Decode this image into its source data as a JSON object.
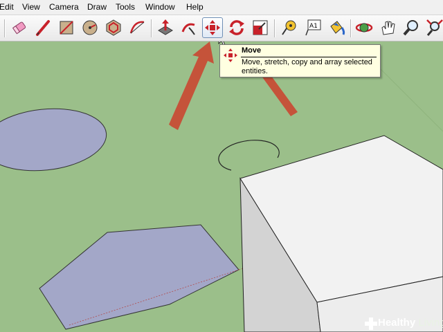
{
  "menu": {
    "items": [
      "Edit",
      "View",
      "Camera",
      "Draw",
      "Tools",
      "Window",
      "Help"
    ]
  },
  "toolbar": {
    "tools": [
      {
        "name": "eraser-icon"
      },
      {
        "name": "pencil-icon"
      },
      {
        "name": "rectangle-icon"
      },
      {
        "name": "circle-icon"
      },
      {
        "name": "polygon-icon"
      },
      {
        "name": "arc-icon"
      },
      {
        "name": "push-pull-icon"
      },
      {
        "name": "follow-me-icon"
      },
      {
        "name": "move-icon",
        "active": true
      },
      {
        "name": "rotate-icon"
      },
      {
        "name": "scale-icon"
      },
      {
        "name": "tape-measure-icon"
      },
      {
        "name": "text-icon"
      },
      {
        "name": "paint-bucket-icon"
      },
      {
        "name": "orbit-icon"
      },
      {
        "name": "pan-icon"
      },
      {
        "name": "zoom-icon"
      },
      {
        "name": "zoom-extents-icon"
      }
    ],
    "text_tool_label": "A1"
  },
  "tooltip": {
    "title": "Move",
    "description": "Move, stretch, copy and array selected entities."
  },
  "watermark": {
    "text": "Healthy",
    "accent": "Living"
  },
  "colors": {
    "ground": "#9bbf8a",
    "shape_fill": "#a3a7c8",
    "arrow": "#c5533a",
    "box_top": "#f2f2f2",
    "box_side": "#d3d3d3"
  }
}
